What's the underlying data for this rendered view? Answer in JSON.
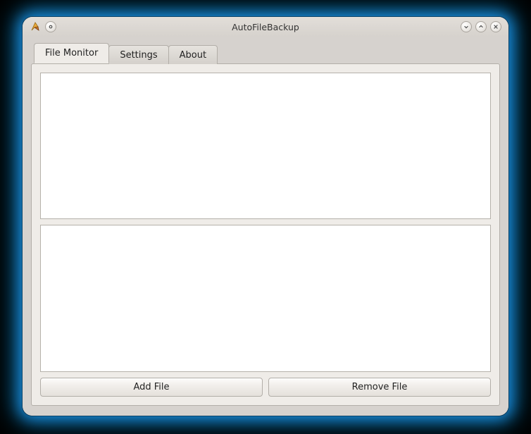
{
  "window": {
    "title": "AutoFileBackup"
  },
  "tabs": [
    {
      "label": "File Monitor",
      "active": true
    },
    {
      "label": "Settings",
      "active": false
    },
    {
      "label": "About",
      "active": false
    }
  ],
  "buttons": {
    "add_file": "Add File",
    "remove_file": "Remove File"
  }
}
